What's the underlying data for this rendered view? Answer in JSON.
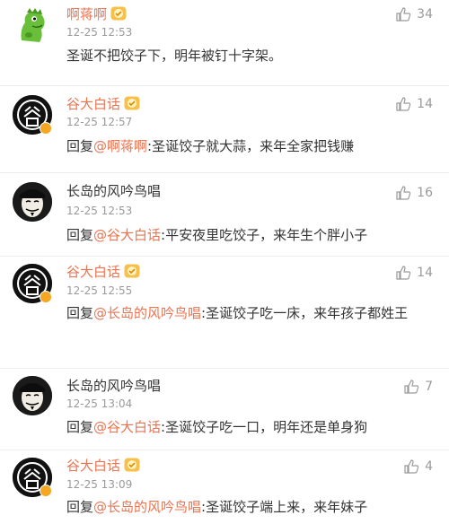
{
  "comments": [
    {
      "user": "啊蒋啊",
      "name_style": "orange",
      "level_badge": true,
      "time": "12-25 12:53",
      "text": "圣诞不把饺子下，明年被钉十字架。",
      "likes": "34",
      "avatar": "dinosaur-avatar"
    },
    {
      "user": "谷大白话",
      "name_style": "orange",
      "level_badge": true,
      "verified": true,
      "time": "12-25 12:57",
      "reply_prefix": "回复",
      "mention": "@啊蒋啊",
      "text": ":圣诞饺子就大蒜，来年全家把钱赚",
      "likes": "14",
      "avatar": "gu-avatar"
    },
    {
      "user": "长岛的风吟鸟唱",
      "name_style": "dark",
      "level_badge": false,
      "time": "12-25 12:53",
      "reply_prefix": "回复",
      "mention": "@谷大白话",
      "text": ":平安夜里吃饺子，来年生个胖小子",
      "likes": "16",
      "avatar": "mask-avatar"
    },
    {
      "user": "谷大白话",
      "name_style": "orange",
      "level_badge": true,
      "verified": true,
      "time": "12-25 12:55",
      "reply_prefix": "回复",
      "mention": "@长岛的风吟鸟唱",
      "text": ":圣诞饺子吃一床，来年孩子都姓王",
      "likes": "14",
      "avatar": "gu-avatar"
    },
    {
      "user": "长岛的风吟鸟唱",
      "name_style": "dark",
      "level_badge": false,
      "time": "12-25 13:04",
      "reply_prefix": "回复",
      "mention": "@谷大白话",
      "text": ":圣诞饺子吃一口，明年还是单身狗",
      "likes": "7",
      "avatar": "mask-avatar"
    },
    {
      "user": "谷大白话",
      "name_style": "orange",
      "level_badge": true,
      "verified": true,
      "time": "12-25 13:09",
      "reply_prefix": "回复",
      "mention": "@长岛的风吟鸟唱",
      "text": ":圣诞饺子端上来，来年妹子",
      "likes": "4",
      "avatar": "gu-avatar"
    }
  ],
  "colors": {
    "accent": "#eb7350",
    "text": "#333333",
    "muted": "#9a9a9a",
    "badge": "#f5a623"
  }
}
